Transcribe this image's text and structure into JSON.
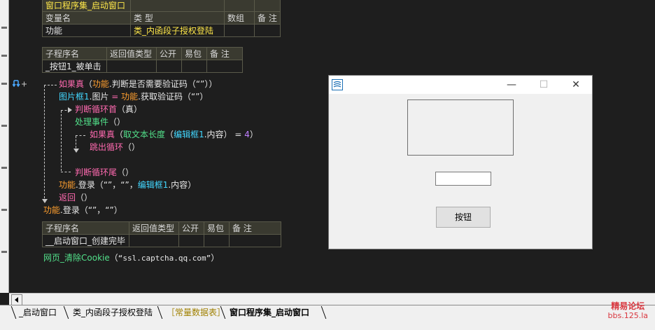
{
  "table1": {
    "row0": "窗口程序集_启动窗口",
    "headers": [
      "变量名",
      "类 型",
      "数组",
      "备 注"
    ],
    "row": [
      "功能",
      "类_内函段子授权登陆",
      "",
      ""
    ]
  },
  "table2": {
    "headers": [
      "子程序名",
      "返回值类型",
      "公开",
      "易包",
      "备 注"
    ],
    "row": [
      "_按钮1_被单击",
      "",
      "",
      "",
      ""
    ]
  },
  "code": {
    "l1_kw": "如果真",
    "l1_a": "（",
    "l1_obj": "功能",
    "l1_dot": ".",
    "l1_method": "判断是否需要验证码",
    "l1_args": "（“”））",
    "l2_obj": "图片框1",
    "l2_prop": ".图片",
    "l2_eq": " = ",
    "l2_obj2": "功能",
    "l2_method": ".获取验证码",
    "l2_args": "（“”）",
    "l3_kw": "判断循环首",
    "l3_args": "（真）",
    "l4_kw": "处理事件",
    "l4_args": "（）",
    "l5_kw": "如果真",
    "l5_a": "（",
    "l5_fn": "取文本长度",
    "l5_b": "（",
    "l5_obj": "编辑框1",
    "l5_prop": ".内容",
    "l5_c": "） = ",
    "l5_num": "4",
    "l5_d": "）",
    "l6_kw": "跳出循环",
    "l6_args": "（）",
    "l7_kw": "判断循环尾",
    "l7_args": "（）",
    "l8_obj": "功能",
    "l8_method": ".登录",
    "l8_a": "（“”，“”，",
    "l8_obj2": "编辑框1",
    "l8_prop": ".内容",
    "l8_b": "）",
    "l9_kw": "返回",
    "l9_args": "（）",
    "l10_obj": "功能",
    "l10_method": ".登录",
    "l10_args": "（“”，“”）"
  },
  "table3": {
    "headers": [
      "子程序名",
      "返回值类型",
      "公开",
      "易包",
      "备 注"
    ],
    "row": [
      "__启动窗口_创建完毕",
      "",
      "",
      "",
      ""
    ]
  },
  "code2": {
    "fn": "网页_清除Cookie",
    "a": "（",
    "str": "“ssl.captcha.qq.com”",
    "b": "）"
  },
  "dialog": {
    "minimize": "—",
    "maximize": "☐",
    "close": "✕",
    "button_label": "按钮"
  },
  "tabs": [
    "_启动窗口",
    "类_内函段子授权登陆",
    "［常量数据表］",
    "窗口程序集_启动窗口"
  ],
  "logo": {
    "line1": "精易论坛",
    "line2": "bbs.125.la"
  },
  "colors": {
    "accent": "#ff6ab0",
    "keyword": "#ff6ab0",
    "object": "#ff9f2f",
    "method": "#42d7ff"
  }
}
